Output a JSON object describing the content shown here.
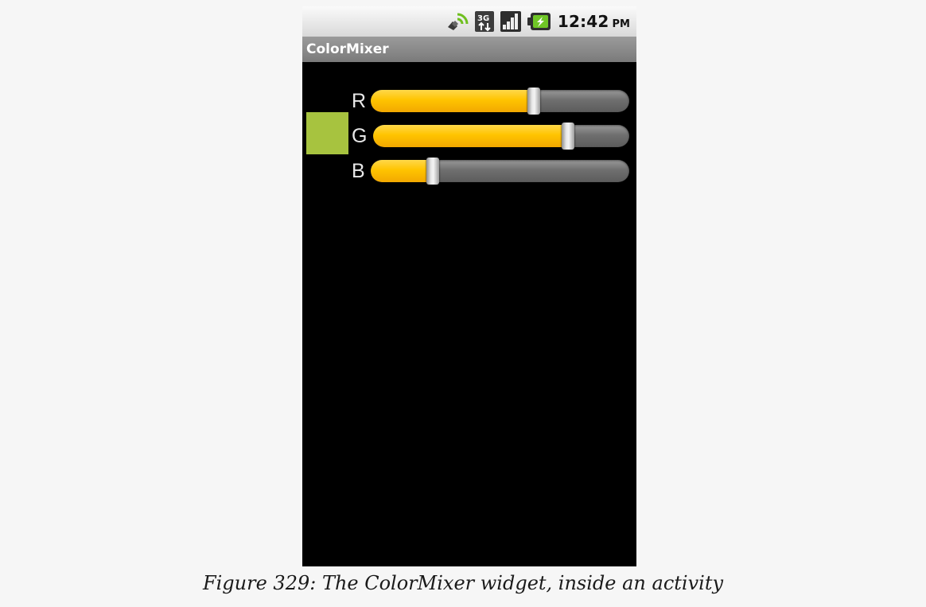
{
  "statusbar": {
    "time": "12:42",
    "ampm": "PM",
    "icons": [
      "gps-signal-icon",
      "3g-data-icon",
      "signal-bars-icon",
      "battery-charging-icon"
    ]
  },
  "app": {
    "title": "ColorMixer"
  },
  "mixer": {
    "swatch_color": "#a7c33f",
    "accent_color": "#ffc400",
    "sliders": [
      {
        "label": "R",
        "value_fraction": 0.63
      },
      {
        "label": "G",
        "value_fraction": 0.76
      },
      {
        "label": "B",
        "value_fraction": 0.24
      }
    ]
  },
  "caption": "Figure 329: The ColorMixer widget, inside an activity"
}
